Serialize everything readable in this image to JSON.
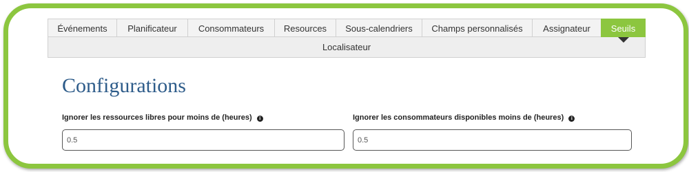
{
  "tabs": [
    {
      "label": "Événements",
      "active": false
    },
    {
      "label": "Planificateur",
      "active": false
    },
    {
      "label": "Consommateurs",
      "active": false
    },
    {
      "label": "Resources",
      "active": false
    },
    {
      "label": "Sous-calendriers",
      "active": false
    },
    {
      "label": "Champs personnalisés",
      "active": false
    },
    {
      "label": "Assignateur",
      "active": false
    },
    {
      "label": "Seuils",
      "active": true
    }
  ],
  "subtabs": {
    "label": "Localisateur"
  },
  "page": {
    "title": "Configurations"
  },
  "fields": [
    {
      "label": "Ignorer les ressources libres pour moins de (heures)",
      "value": "0.5",
      "info_icon": "info-circle-icon"
    },
    {
      "label": "Ignorer les consommateurs disponibles moins de (heures)",
      "value": "0.5",
      "info_icon": "info-circle-icon"
    }
  ],
  "colors": {
    "accent": "#8cc63f",
    "title": "#2e5c8a",
    "tab_background": "#f3f3f3"
  }
}
